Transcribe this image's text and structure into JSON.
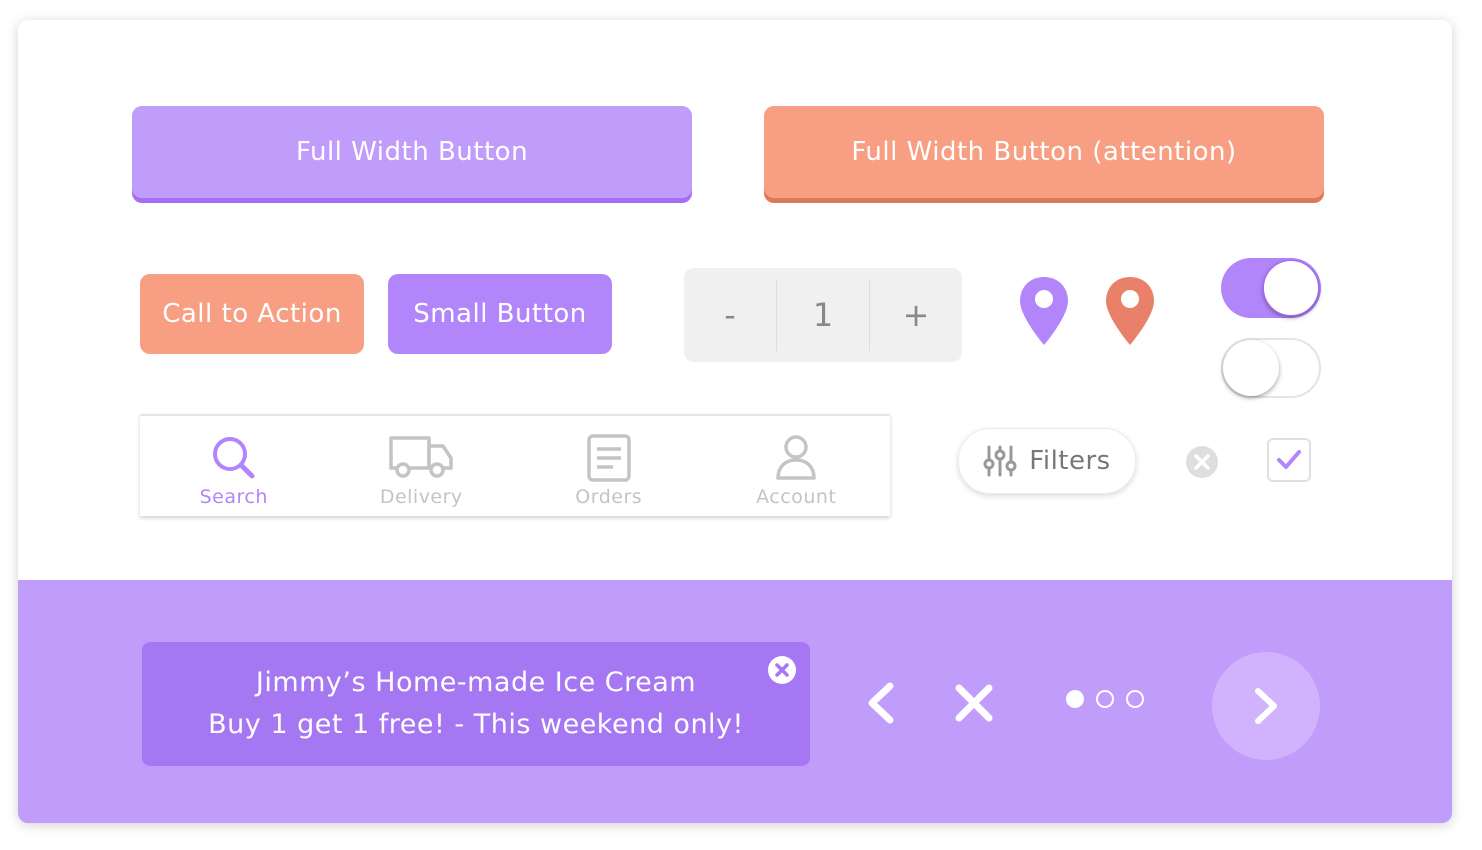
{
  "buttons": {
    "full_width": "Full Width Button",
    "full_width_attention": "Full Width Button (attention)",
    "call_to_action": "Call to Action",
    "small": "Small Button"
  },
  "stepper": {
    "minus": "-",
    "value": "1",
    "plus": "+"
  },
  "colors": {
    "purple": "#c09cfb",
    "purple_dark": "#a677f3",
    "orange": "#f89e83",
    "orange_pin": "#e8806a"
  },
  "toggles": [
    {
      "state": "on"
    },
    {
      "state": "off"
    }
  ],
  "tabbar": {
    "tabs": [
      {
        "label": "Search",
        "icon": "search-icon",
        "active": true
      },
      {
        "label": "Delivery",
        "icon": "truck-icon",
        "active": false
      },
      {
        "label": "Orders",
        "icon": "document-icon",
        "active": false
      },
      {
        "label": "Account",
        "icon": "user-icon",
        "active": false
      }
    ]
  },
  "filters": {
    "label": "Filters",
    "icon": "sliders-icon"
  },
  "checkbox": {
    "checked": true
  },
  "toast": {
    "line1": "Jimmy’s Home-made Ice Cream",
    "line2": "Buy 1 get 1 free! - This weekend only!"
  },
  "pagination": {
    "count": 3,
    "active_index": 0
  }
}
